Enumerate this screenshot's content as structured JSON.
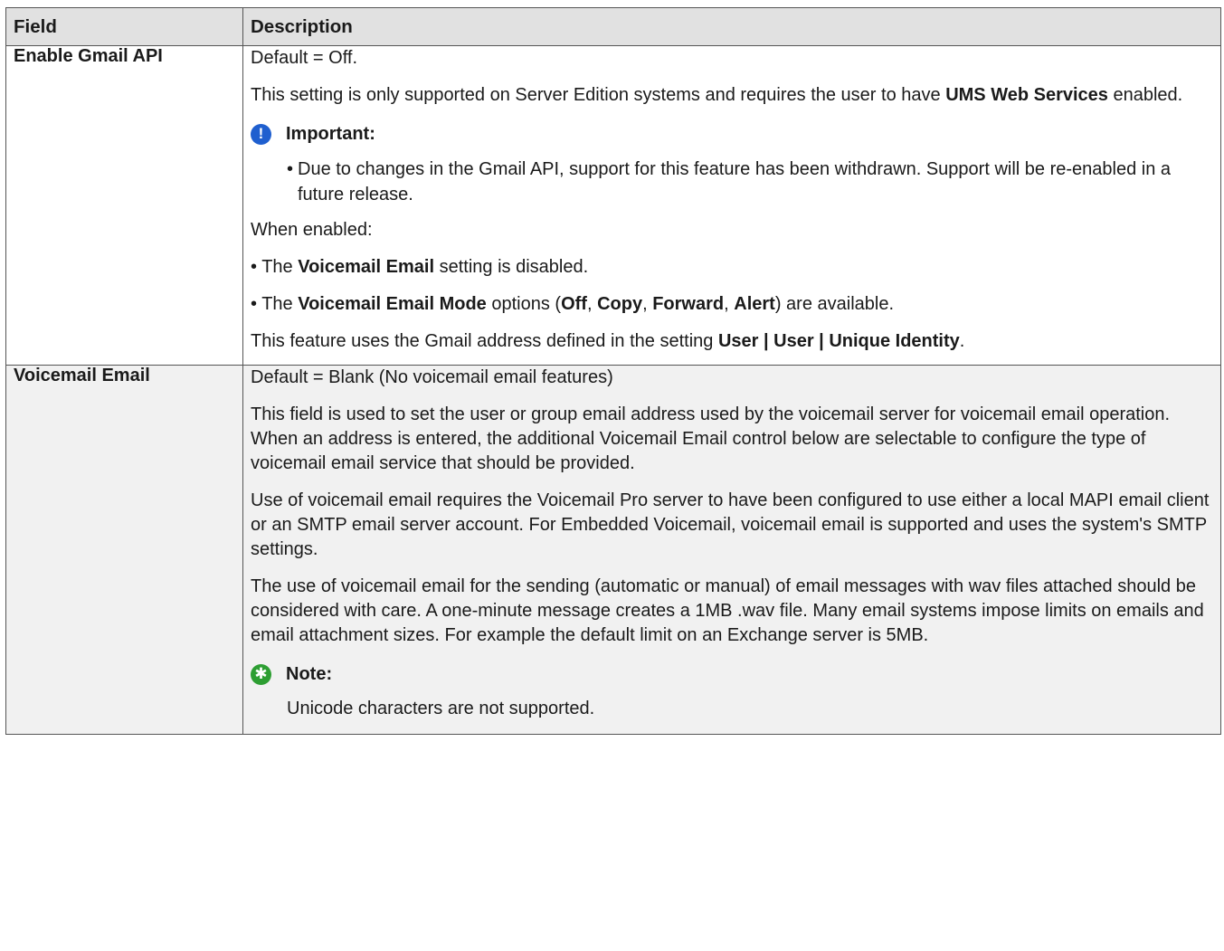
{
  "table": {
    "headers": {
      "field": "Field",
      "description": "Description"
    },
    "rows": [
      {
        "field": "Enable Gmail API",
        "default": "Default = Off.",
        "para1_pre": "This setting is only supported on Server Edition systems and requires the user to have ",
        "para1_bold": "UMS Web Services",
        "para1_post": " enabled.",
        "important_title": "Important:",
        "important_item": "Due to changes in the Gmail API, support for this feature has been withdrawn. Support will be re-enabled in a future release.",
        "when_enabled": "When enabled:",
        "bullet1_pre": "• The ",
        "bullet1_bold": "Voicemail Email",
        "bullet1_post": " setting is disabled.",
        "bullet2_pre": "• The ",
        "bullet2_bold": "Voicemail Email Mode",
        "bullet2_mid1": " options (",
        "bullet2_opt1": "Off",
        "bullet2_sep1": ", ",
        "bullet2_opt2": "Copy",
        "bullet2_sep2": ", ",
        "bullet2_opt3": "Forward",
        "bullet2_sep3": ", ",
        "bullet2_opt4": "Alert",
        "bullet2_post": ") are available.",
        "last_pre": "This feature uses the Gmail address defined in the setting ",
        "last_bold": "User | User | Unique Identity",
        "last_post": "."
      },
      {
        "field": "Voicemail Email",
        "default": "Default = Blank (No voicemail email features)",
        "para1": "This field is used to set the user or group email address used by the voicemail server for voicemail email operation. When an address is entered, the additional Voicemail Email control below are selectable to configure the type of voicemail email service that should be provided.",
        "para2": "Use of voicemail email requires the Voicemail Pro server to have been configured to use either a local MAPI email client or an SMTP email server account. For Embedded Voicemail, voicemail email is supported and uses the system's SMTP settings.",
        "para3": "The use of voicemail email for the sending (automatic or manual) of email messages with wav files attached should be considered with care. A one-minute message creates a 1MB .wav file. Many email systems impose limits on emails and email attachment sizes. For example the default limit on an Exchange server is 5MB.",
        "note_title": "Note:",
        "note_text": "Unicode characters are not supported."
      }
    ]
  },
  "icons": {
    "important": {
      "name": "exclamation-icon",
      "glyph": "!",
      "color": "#1f5fcf"
    },
    "note": {
      "name": "asterisk-icon",
      "glyph": "✱",
      "color": "#2d9e32"
    }
  }
}
